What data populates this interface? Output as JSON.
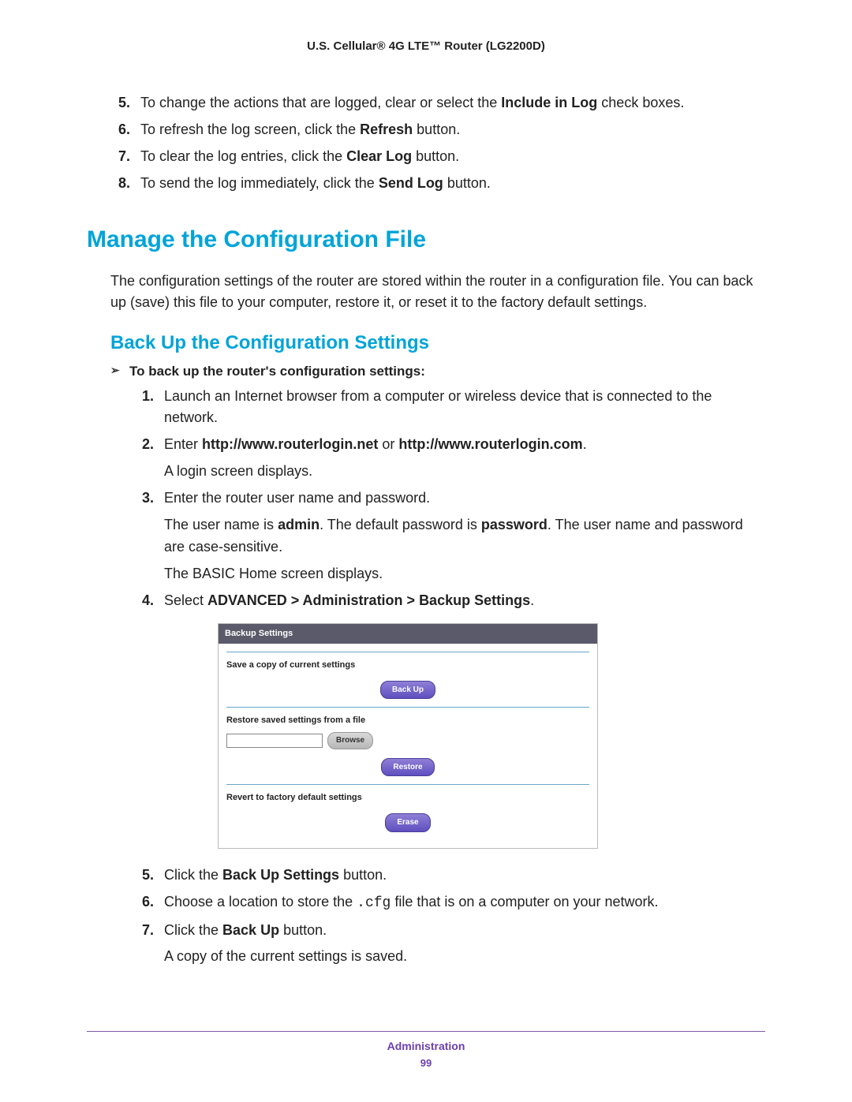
{
  "header": {
    "title": "U.S. Cellular® 4G LTE™ Router (LG2200D)"
  },
  "top_steps": {
    "start": 5,
    "items": [
      {
        "pre": "To change the actions that are logged, clear or select the ",
        "bold": "Include in Log",
        "post": " check boxes."
      },
      {
        "pre": "To refresh the log screen, click the ",
        "bold": "Refresh",
        "post": " button."
      },
      {
        "pre": "To clear the log entries, click the ",
        "bold": "Clear Log",
        "post": " button."
      },
      {
        "pre": "To send the log immediately, click the ",
        "bold": "Send Log",
        "post": " button."
      }
    ]
  },
  "section": {
    "h1": "Manage the Configuration File",
    "intro": "The configuration settings of the router are stored within the router in a configuration file. You can back up (save) this file to your computer, restore it, or reset it to the factory default settings.",
    "h2": "Back Up the Configuration Settings",
    "task": "To back up the router's configuration settings:",
    "steps": {
      "s1": "Launch an Internet browser from a computer or wireless device that is connected to the network.",
      "s2_pre": "Enter ",
      "s2_b1": "http://www.routerlogin.net",
      "s2_mid": " or ",
      "s2_b2": "http://www.routerlogin.com",
      "s2_post": ".",
      "s2_p": "A login screen displays.",
      "s3": "Enter the router user name and password.",
      "s3_pA": "The user name is ",
      "s3_pA_b1": "admin",
      "s3_pA_mid": ". The default password is ",
      "s3_pA_b2": "password",
      "s3_pA_post": ". The user name and password are case-sensitive.",
      "s3_pB": "The BASIC Home screen displays.",
      "s4_pre": "Select ",
      "s4_b": "ADVANCED > Administration > Backup Settings",
      "s4_post": ".",
      "s5_pre": "Click the ",
      "s5_b": "Back Up Settings",
      "s5_post": " button.",
      "s6_pre": "Choose a location to store the ",
      "s6_mono": ".cfg",
      "s6_post": " file that is on a computer on your network.",
      "s7_pre": "Click the ",
      "s7_b": "Back Up",
      "s7_post": " button.",
      "s7_p": "A copy of the current settings is saved."
    }
  },
  "panel": {
    "title": "Backup Settings",
    "label1": "Save a copy of current settings",
    "btn_backup": "Back Up",
    "label2": "Restore saved settings from a file",
    "btn_browse": "Browse",
    "btn_restore": "Restore",
    "label3": "Revert to factory default settings",
    "btn_erase": "Erase"
  },
  "footer": {
    "category": "Administration",
    "page": "99"
  }
}
